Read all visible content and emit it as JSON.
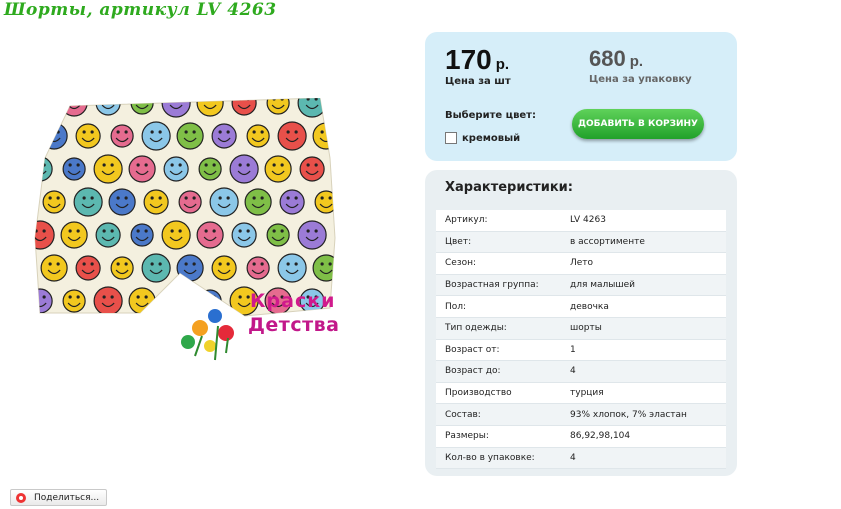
{
  "page": {
    "title": "Шорты, артикул LV 4263"
  },
  "logo": {
    "line1": "Краски",
    "line2": "Детства"
  },
  "price": {
    "unit_value": "170",
    "currency": "р.",
    "unit_caption": "Цена за шт",
    "pack_value": "680",
    "pack_currency": "р.",
    "pack_caption": "Цена за упаковку",
    "color_label": "Выберите цвет:",
    "color_option": "кремовый",
    "add_to_cart": "ДОБАВИТЬ В КОРЗИНУ"
  },
  "specs": {
    "title": "Характеристики:",
    "rows": [
      {
        "key": "Артикул:",
        "value": "LV 4263"
      },
      {
        "key": "Цвет:",
        "value": "в ассортименте"
      },
      {
        "key": "Сезон:",
        "value": "Лето"
      },
      {
        "key": "Возрастная группа:",
        "value": "для малышей"
      },
      {
        "key": "Пол:",
        "value": "девочка"
      },
      {
        "key": "Тип одежды:",
        "value": "шорты"
      },
      {
        "key": "Возраст от:",
        "value": "1"
      },
      {
        "key": "Возраст до:",
        "value": "4"
      },
      {
        "key": "Производство",
        "value": "турция"
      },
      {
        "key": "Состав:",
        "value": "93% хлопок, 7% эластан"
      },
      {
        "key": "Размеры:",
        "value": "86,92,98,104"
      },
      {
        "key": "Кол-во в упаковке:",
        "value": "4"
      }
    ]
  },
  "share": {
    "label": "Поделиться..."
  },
  "colors": {
    "title_green": "#2eaa1e",
    "price_box_bg": "#d6eef9",
    "cart_button": "#2fb232",
    "specs_bg": "#e9eff2"
  },
  "icons": {
    "share": "share-icon",
    "checkbox": "checkbox-icon"
  }
}
